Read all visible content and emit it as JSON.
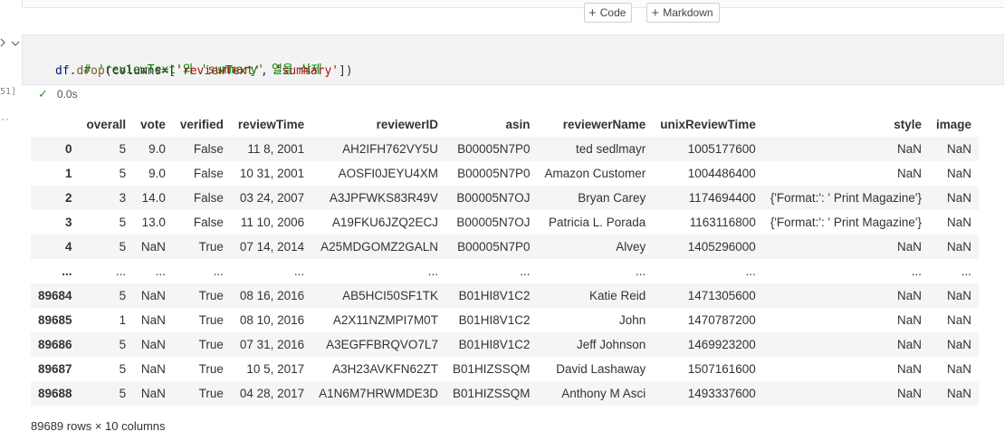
{
  "toolbar": {
    "add_code_label": "Code",
    "add_markdown_label": "Markdown"
  },
  "cell": {
    "execution_count": "51]",
    "code_line1": "# 'reviewText'와 'summary' 열을 삭제",
    "code_line2": {
      "obj": "df",
      "dot": ".",
      "fn": "drop",
      "open": "(columns=[",
      "arg1": "'reviewText'",
      "sep": ", ",
      "arg2": "'summary'",
      "close": "])"
    },
    "exec_time": "0.0s",
    "status_icon": "check-icon",
    "success_color": "#388a34"
  },
  "output": {
    "columns": [
      "",
      "overall",
      "vote",
      "verified",
      "reviewTime",
      "reviewerID",
      "asin",
      "reviewerName",
      "unixReviewTime",
      "style",
      "image"
    ],
    "rows": [
      [
        "0",
        "5",
        "9.0",
        "False",
        "11 8, 2001",
        "AH2IFH762VY5U",
        "B00005N7P0",
        "ted sedlmayr",
        "1005177600",
        "NaN",
        "NaN"
      ],
      [
        "1",
        "5",
        "9.0",
        "False",
        "10 31, 2001",
        "AOSFI0JEYU4XM",
        "B00005N7P0",
        "Amazon Customer",
        "1004486400",
        "NaN",
        "NaN"
      ],
      [
        "2",
        "3",
        "14.0",
        "False",
        "03 24, 2007",
        "A3JPFWKS83R49V",
        "B00005N7OJ",
        "Bryan Carey",
        "1174694400",
        "{'Format:': ' Print Magazine'}",
        "NaN"
      ],
      [
        "3",
        "5",
        "13.0",
        "False",
        "11 10, 2006",
        "A19FKU6JZQ2ECJ",
        "B00005N7OJ",
        "Patricia L. Porada",
        "1163116800",
        "{'Format:': ' Print Magazine'}",
        "NaN"
      ],
      [
        "4",
        "5",
        "NaN",
        "True",
        "07 14, 2014",
        "A25MDGOMZ2GALN",
        "B00005N7P0",
        "Alvey",
        "1405296000",
        "NaN",
        "NaN"
      ],
      [
        "...",
        "...",
        "...",
        "...",
        "...",
        "...",
        "...",
        "...",
        "...",
        "...",
        "..."
      ],
      [
        "89684",
        "5",
        "NaN",
        "True",
        "08 16, 2016",
        "AB5HCI50SF1TK",
        "B01HI8V1C2",
        "Katie Reid",
        "1471305600",
        "NaN",
        "NaN"
      ],
      [
        "89685",
        "1",
        "NaN",
        "True",
        "08 10, 2016",
        "A2X11NZMPI7M0T",
        "B01HI8V1C2",
        "John",
        "1470787200",
        "NaN",
        "NaN"
      ],
      [
        "89686",
        "5",
        "NaN",
        "True",
        "07 31, 2016",
        "A3EGFFBRQVO7L7",
        "B01HI8V1C2",
        "Jeff Johnson",
        "1469923200",
        "NaN",
        "NaN"
      ],
      [
        "89687",
        "5",
        "NaN",
        "True",
        "10 5, 2017",
        "A3H23AVKFN62ZT",
        "B01HIZSSQM",
        "David Lashaway",
        "1507161600",
        "NaN",
        "NaN"
      ],
      [
        "89688",
        "5",
        "NaN",
        "True",
        "04 28, 2017",
        "A1N6M7HRWMDE3D",
        "B01HIZSSQM",
        "Anthony M Asci",
        "1493337600",
        "NaN",
        "NaN"
      ]
    ],
    "shape_text": "89689 rows × 10 columns"
  }
}
